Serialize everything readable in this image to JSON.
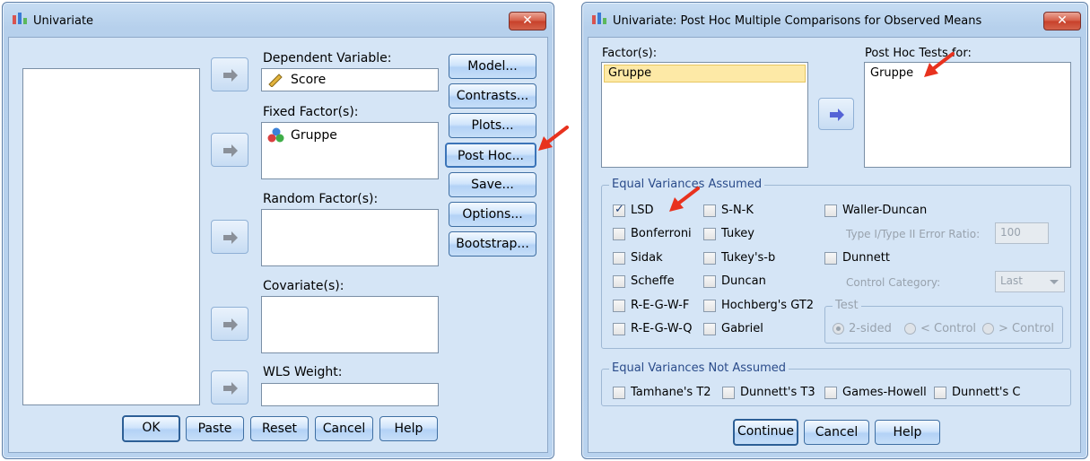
{
  "univariate": {
    "title": "Univariate",
    "close_label": "✕",
    "dependent_label": "Dependent Variable:",
    "dependent_value": "Score",
    "fixed_label": "Fixed Factor(s):",
    "fixed_value": "Gruppe",
    "random_label": "Random Factor(s):",
    "covariate_label": "Covariate(s):",
    "wls_label": "WLS Weight:",
    "side_buttons": {
      "model": "Model...",
      "contrasts": "Contrasts...",
      "plots": "Plots...",
      "posthoc": "Post Hoc...",
      "save": "Save...",
      "options": "Options...",
      "bootstrap": "Bootstrap..."
    },
    "bottom_buttons": {
      "ok": "OK",
      "paste": "Paste",
      "reset": "Reset",
      "cancel": "Cancel",
      "help": "Help"
    }
  },
  "posthoc": {
    "title": "Univariate: Post Hoc Multiple Comparisons for Observed Means",
    "close_label": "✕",
    "factors_label": "Factor(s):",
    "factors_value": "Gruppe",
    "tests_for_label": "Post Hoc Tests for:",
    "tests_for_value": "Gruppe",
    "equal_assumed_title": "Equal Variances Assumed",
    "equal_not_assumed_title": "Equal Variances Not Assumed",
    "checks": {
      "lsd": "LSD",
      "bonferroni": "Bonferroni",
      "sidak": "Sidak",
      "scheffe": "Scheffe",
      "regwf": "R-E-G-W-F",
      "regwq": "R-E-G-W-Q",
      "snk": "S-N-K",
      "tukey": "Tukey",
      "tukeyb": "Tukey's-b",
      "duncan": "Duncan",
      "hochberg": "Hochberg's GT2",
      "gabriel": "Gabriel",
      "waller": "Waller-Duncan",
      "dunnett": "Dunnett",
      "tamhane": "Tamhane's T2",
      "dunnett_t3": "Dunnett's T3",
      "games_howell": "Games-Howell",
      "dunnett_c": "Dunnett's C"
    },
    "checked": [
      "lsd"
    ],
    "error_ratio_label": "Type I/Type II Error Ratio:",
    "error_ratio_value": "100",
    "control_category_label": "Control Category:",
    "control_category_value": "Last",
    "test_title": "Test",
    "radios": {
      "two_sided": "2-sided",
      "lt_control": "< Control",
      "gt_control": "> Control"
    },
    "buttons": {
      "continue": "Continue",
      "cancel": "Cancel",
      "help": "Help"
    }
  },
  "colors": {
    "annotation_arrow": "#e8321e",
    "selection": "#fde9a6"
  }
}
